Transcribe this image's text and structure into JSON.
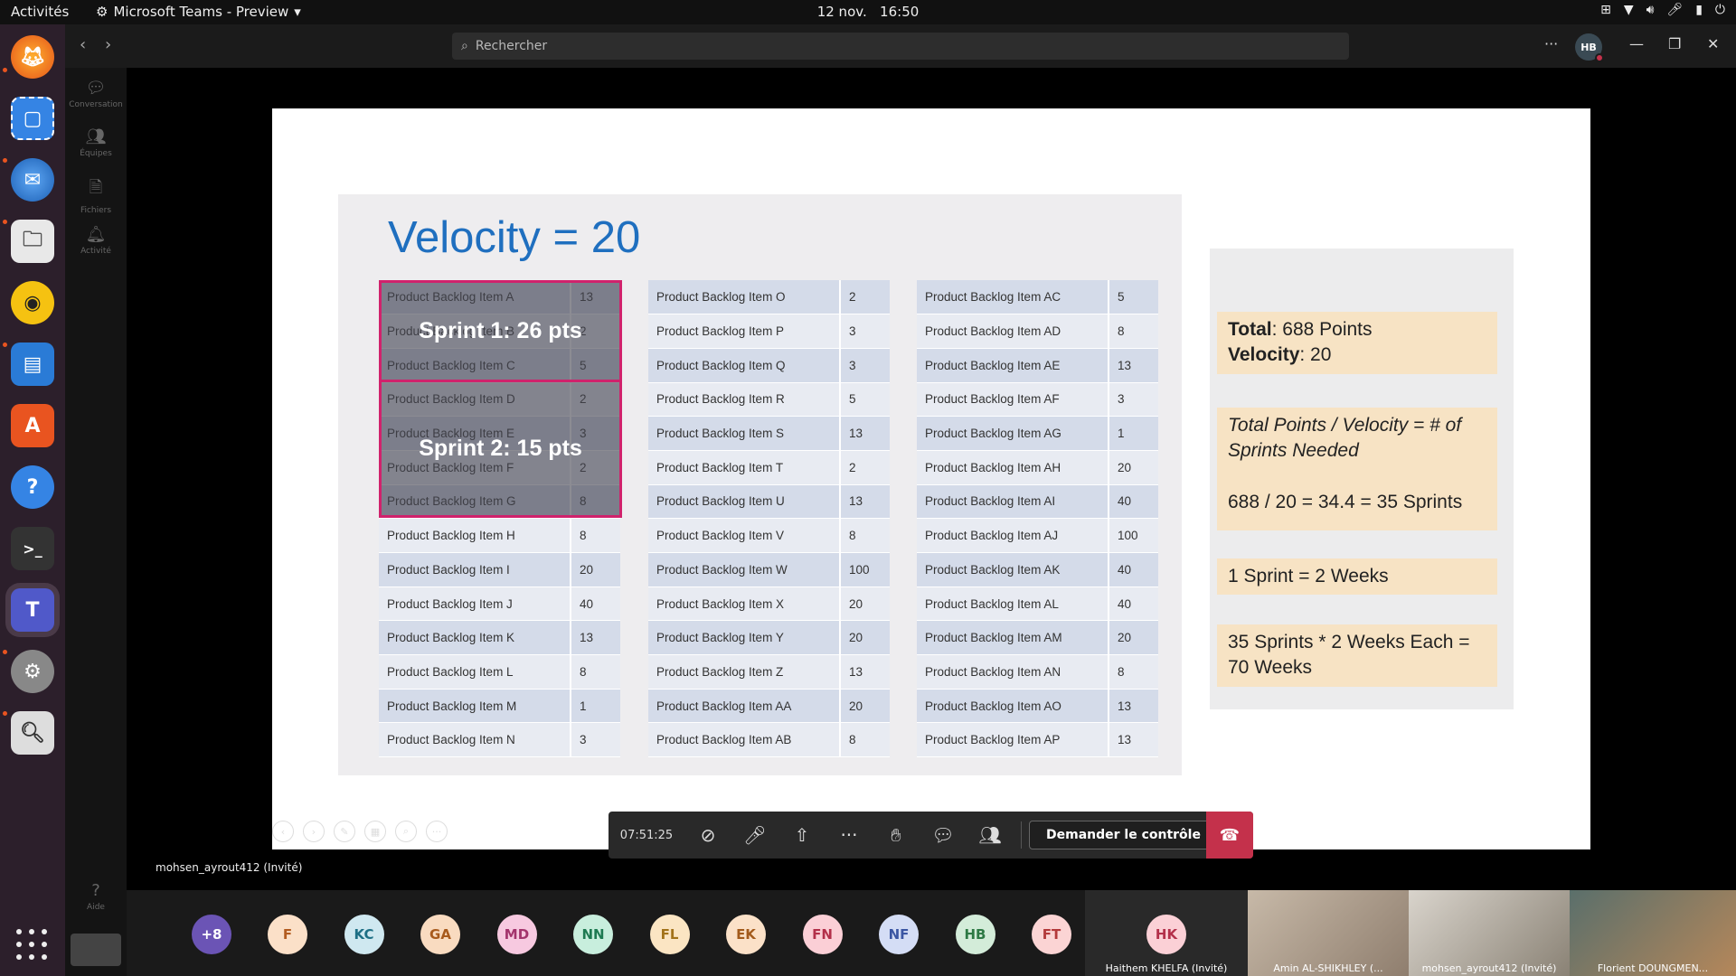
{
  "topbar": {
    "activities": "Activités",
    "app_name": "Microsoft Teams - Preview",
    "date": "12 nov.",
    "time": "16:50"
  },
  "teams": {
    "search_placeholder": "Rechercher",
    "avatar_initials": "HB",
    "rail": [
      "Conversation",
      "Équipes",
      "Fichiers",
      "Activité"
    ],
    "help_label": "Aide"
  },
  "slide": {
    "title": "Velocity = 20",
    "col1": [
      [
        "Product Backlog Item A",
        "13"
      ],
      [
        "Product Backlog Item B",
        "2"
      ],
      [
        "Product Backlog Item C",
        "5"
      ],
      [
        "Product Backlog Item D",
        "2"
      ],
      [
        "Product Backlog Item E",
        "3"
      ],
      [
        "Product Backlog Item F",
        "2"
      ],
      [
        "Product Backlog Item G",
        "8"
      ],
      [
        "Product Backlog Item H",
        "8"
      ],
      [
        "Product Backlog Item I",
        "20"
      ],
      [
        "Product Backlog Item J",
        "40"
      ],
      [
        "Product Backlog Item K",
        "13"
      ],
      [
        "Product Backlog Item L",
        "8"
      ],
      [
        "Product Backlog Item M",
        "1"
      ],
      [
        "Product Backlog Item N",
        "3"
      ]
    ],
    "col2": [
      [
        "Product Backlog Item O",
        "2"
      ],
      [
        "Product Backlog Item P",
        "3"
      ],
      [
        "Product Backlog Item Q",
        "3"
      ],
      [
        "Product Backlog Item R",
        "5"
      ],
      [
        "Product Backlog Item S",
        "13"
      ],
      [
        "Product Backlog Item T",
        "2"
      ],
      [
        "Product Backlog Item U",
        "13"
      ],
      [
        "Product Backlog Item V",
        "8"
      ],
      [
        "Product Backlog Item W",
        "100"
      ],
      [
        "Product Backlog Item X",
        "20"
      ],
      [
        "Product Backlog Item Y",
        "20"
      ],
      [
        "Product Backlog Item Z",
        "13"
      ],
      [
        "Product Backlog Item AA",
        "20"
      ],
      [
        "Product Backlog Item AB",
        "8"
      ]
    ],
    "col3": [
      [
        "Product Backlog Item AC",
        "5"
      ],
      [
        "Product Backlog Item AD",
        "8"
      ],
      [
        "Product Backlog Item AE",
        "13"
      ],
      [
        "Product Backlog Item AF",
        "3"
      ],
      [
        "Product Backlog Item AG",
        "1"
      ],
      [
        "Product Backlog Item AH",
        "20"
      ],
      [
        "Product Backlog Item AI",
        "40"
      ],
      [
        "Product Backlog Item AJ",
        "100"
      ],
      [
        "Product Backlog Item AK",
        "40"
      ],
      [
        "Product Backlog Item AL",
        "40"
      ],
      [
        "Product Backlog Item AM",
        "20"
      ],
      [
        "Product Backlog Item AN",
        "8"
      ],
      [
        "Product Backlog Item AO",
        "13"
      ],
      [
        "Product Backlog Item AP",
        "13"
      ]
    ],
    "sprint1": "Sprint 1: 26 pts",
    "sprint2": "Sprint 2: 15 pts",
    "notes": {
      "total_label": "Total",
      "total_value": ": 688 Points",
      "velocity_label": "Velocity",
      "velocity_value": ": 20",
      "formula": "Total Points / Velocity = # of Sprints Needed",
      "calc": "688 / 20 = 34.4 = 35 Sprints",
      "sprint_len": "1 Sprint = 2 Weeks",
      "weeks": "35 Sprints * 2 Weeks Each = 70 Weeks"
    }
  },
  "call": {
    "timer": "07:51:25",
    "request_control": "Demander le contrôle",
    "presenter": "mohsen_ayrout412 (Invité)"
  },
  "participants": {
    "more": "+8",
    "initials": [
      "F",
      "KC",
      "GA",
      "MD",
      "NN",
      "FL",
      "EK",
      "FN",
      "NF",
      "HB",
      "FT"
    ],
    "colors": [
      "#fbe0c8",
      "#cfe8f0",
      "#f9dbc0",
      "#f7c9e0",
      "#c8eedd",
      "#fbe5c3",
      "#fbe1c8",
      "#fbcfd6",
      "#d4ddf5",
      "#d3ecd9",
      "#fbd4d4"
    ],
    "text_colors": [
      "#b35c20",
      "#1d6f85",
      "#a85a1c",
      "#a3336c",
      "#1e7a52",
      "#a3731a",
      "#a35b1c",
      "#b3304a",
      "#3b56a3",
      "#2e7a45",
      "#b3393a"
    ],
    "hk_initials": "HK",
    "hk_name": "Haithem KHELFA (Invité)",
    "video_names": [
      "Amin AL-SHIKHLEY (...",
      "mohsen_ayrout412 (Invité)",
      "Florient DOUNGMEN..."
    ]
  }
}
